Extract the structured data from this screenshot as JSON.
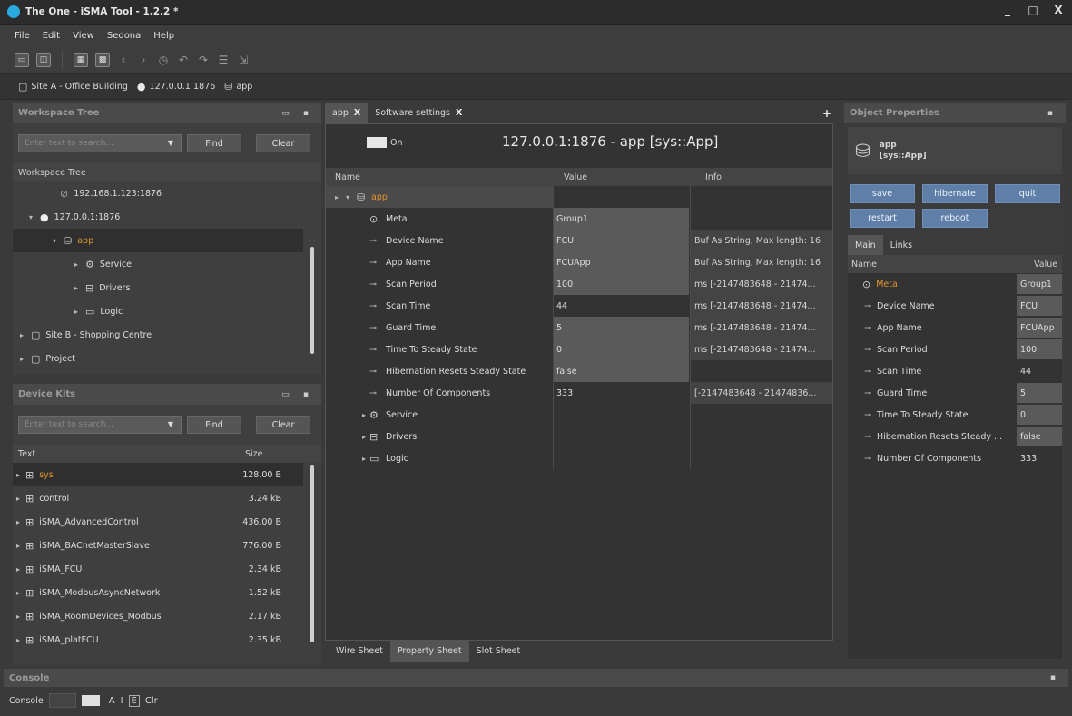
{
  "window": {
    "title": "The One - iSMA Tool - 1.2.2 *",
    "min": "_",
    "max": "□",
    "close": "X"
  },
  "menu": [
    "File",
    "Edit",
    "View",
    "Sedona",
    "Help"
  ],
  "breadcrumb": [
    {
      "label": "Site A - Office Building",
      "icon": "folder-icon"
    },
    {
      "label": "127.0.0.1:1876",
      "icon": "device-icon"
    },
    {
      "label": "app",
      "icon": "database-icon"
    }
  ],
  "workspace": {
    "title": "Workspace Tree",
    "search_placeholder": "Enter text to search...",
    "find": "Find",
    "clear": "Clear",
    "column": "Workspace Tree",
    "items": [
      {
        "label": "192.168.1.123:1876",
        "icon": "device-off-icon"
      },
      {
        "label": "127.0.0.1:1876",
        "icon": "device-icon",
        "arrow": "expanded"
      },
      {
        "label": "app",
        "icon": "database-icon",
        "arrow": "expanded",
        "selected": true
      },
      {
        "label": "Service",
        "icon": "gear-icon",
        "arrow": "collapsed"
      },
      {
        "label": "Drivers",
        "icon": "drivers-icon",
        "arrow": "collapsed"
      },
      {
        "label": "Logic",
        "icon": "folder-icon",
        "arrow": "collapsed"
      },
      {
        "label": "Site B - Shopping Centre",
        "icon": "file-icon",
        "arrow": "collapsed"
      },
      {
        "label": "Project",
        "icon": "file-icon",
        "arrow": "collapsed"
      }
    ]
  },
  "kits": {
    "title": "Device Kits",
    "search_placeholder": "Enter text to search...",
    "find": "Find",
    "clear": "Clear",
    "col_text": "Text",
    "col_size": "Size",
    "items": [
      {
        "name": "sys",
        "size": "128.00 B",
        "selected": true
      },
      {
        "name": "control",
        "size": "3.24 kB"
      },
      {
        "name": "iSMA_AdvancedControl",
        "size": "436.00 B"
      },
      {
        "name": "iSMA_BACnetMasterSlave",
        "size": "776.00 B"
      },
      {
        "name": "iSMA_FCU",
        "size": "2.34 kB"
      },
      {
        "name": "iSMA_ModbusAsyncNetwork",
        "size": "1.52 kB"
      },
      {
        "name": "iSMA_RoomDevices_Modbus",
        "size": "2.17 kB"
      },
      {
        "name": "iSMA_platFCU",
        "size": "2.35 kB"
      }
    ]
  },
  "center": {
    "tabs": [
      {
        "label": "app",
        "close": "X",
        "active": true
      },
      {
        "label": "Software settings",
        "close": "X",
        "active": false
      }
    ],
    "add": "+",
    "toggle": "On",
    "header": "127.0.0.1:1876 - app [sys::App]",
    "columns": [
      "Name",
      "Value",
      "Info"
    ],
    "rows": [
      {
        "name": "app",
        "value": "",
        "info": "",
        "type": "root"
      },
      {
        "name": "Meta",
        "value": "Group1",
        "info": "",
        "type": "meta"
      },
      {
        "name": "Device Name",
        "value": "FCU",
        "info": "Buf As String, Max length: 16",
        "type": "prop"
      },
      {
        "name": "App Name",
        "value": "FCUApp",
        "info": "Buf As String, Max length: 16",
        "type": "prop"
      },
      {
        "name": "Scan Period",
        "value": "100",
        "info": "ms [-2147483648 - 21474...",
        "type": "prop"
      },
      {
        "name": "Scan Time",
        "value": "44",
        "info": "ms [-2147483648 - 21474...",
        "type": "prop"
      },
      {
        "name": "Guard Time",
        "value": "5",
        "info": "ms [-2147483648 - 21474...",
        "type": "prop"
      },
      {
        "name": "Time To Steady State",
        "value": "0",
        "info": "ms [-2147483648 - 21474...",
        "type": "prop"
      },
      {
        "name": "Hibernation Resets Steady State",
        "value": "false",
        "info": "",
        "type": "prop"
      },
      {
        "name": "Number Of Components",
        "value": "333",
        "info": "[-2147483648 - 21474836...",
        "type": "prop"
      },
      {
        "name": "Service",
        "value": "",
        "info": "",
        "type": "folder",
        "icon": "gear-icon"
      },
      {
        "name": "Drivers",
        "value": "",
        "info": "",
        "type": "folder",
        "icon": "drivers-icon"
      },
      {
        "name": "Logic",
        "value": "",
        "info": "",
        "type": "folder",
        "icon": "folder-icon"
      }
    ],
    "bottom_tabs": [
      "Wire Sheet",
      "Property Sheet",
      "Slot Sheet"
    ],
    "bottom_active": 1
  },
  "props": {
    "title": "Object Properties",
    "obj_name": "app",
    "obj_type": "[sys::App]",
    "buttons_row1": [
      "save",
      "hibernate",
      "quit"
    ],
    "buttons_row2": [
      "restart",
      "reboot"
    ],
    "tabs": [
      "Main",
      "Links"
    ],
    "col_name": "Name",
    "col_value": "Value",
    "rows": [
      {
        "name": "Meta",
        "value": "Group1",
        "meta": true
      },
      {
        "name": "Device Name",
        "value": "FCU"
      },
      {
        "name": "App Name",
        "value": "FCUApp"
      },
      {
        "name": "Scan Period",
        "value": "100"
      },
      {
        "name": "Scan Time",
        "value": "44"
      },
      {
        "name": "Guard Time",
        "value": "5"
      },
      {
        "name": "Time To Steady State",
        "value": "0"
      },
      {
        "name": "Hibernation Resets Steady ...",
        "value": "false"
      },
      {
        "name": "Number Of Components",
        "value": "333"
      }
    ]
  },
  "console": {
    "title": "Console",
    "label": "Console",
    "a": "A",
    "i": "I",
    "e": "E",
    "clr": "Clr"
  }
}
